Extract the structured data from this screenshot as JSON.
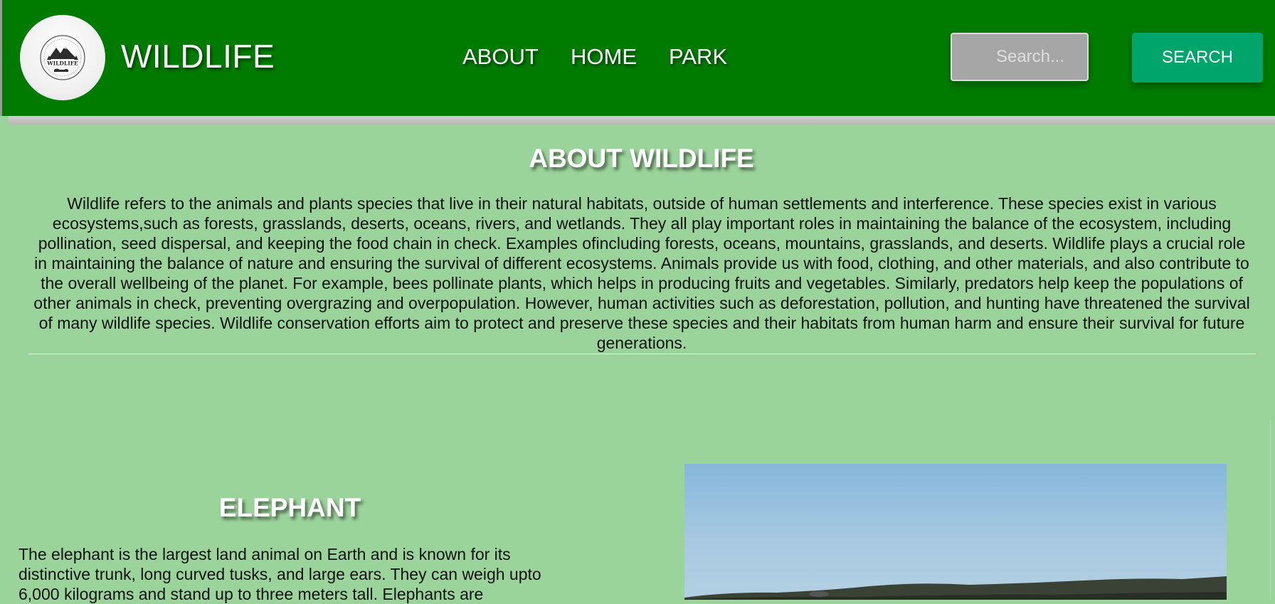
{
  "header": {
    "brand": "WILDLIFE",
    "logo_text": "WILDLIFE",
    "nav": [
      {
        "label": "ABOUT"
      },
      {
        "label": "HOME"
      },
      {
        "label": "PARK"
      }
    ],
    "search": {
      "placeholder": "Search...",
      "value": "",
      "button_label": "SEARCH"
    }
  },
  "about": {
    "title": "ABOUT WILDLIFE",
    "paragraph": "Wildlife refers to the animals and plants species that live in their natural habitats, outside of human settlements and interference. These species exist in various ecosystems,such as forests, grasslands, deserts, oceans, rivers, and wetlands. They all play important roles in maintaining the balance of the ecosystem, including pollination, seed dispersal, and keeping the food chain in check. Examples ofincluding forests, oceans, mountains, grasslands, and deserts. Wildlife plays a crucial role in maintaining the balance of nature and ensuring the survival of different ecosystems. Animals provide us with food, clothing, and other materials, and also contribute to the overall wellbeing of the planet. For example, bees pollinate plants, which helps in producing fruits and vegetables. Similarly, predators help keep the populations of other animals in check, preventing overgrazing and overpopulation. However, human activities such as deforestation, pollution, and hunting have threatened the survival of many wildlife species. Wildlife conservation efforts aim to protect and preserve these species and their habitats from human harm and ensure their survival for future generations."
  },
  "elephant": {
    "title": "ELEPHANT",
    "paragraph": "The elephant is the largest land animal on Earth and is known for its distinctive trunk, long curved tusks, and large ears. They can weigh upto 6,000 kilograms and stand up to three meters tall. Elephants are"
  },
  "colors": {
    "header": "#007b00",
    "page_background": "#9bd49a",
    "search_button": "#00a56b",
    "search_input": "#a6a6a6"
  },
  "icons": {
    "logo": "mountain-bear-badge-icon"
  }
}
